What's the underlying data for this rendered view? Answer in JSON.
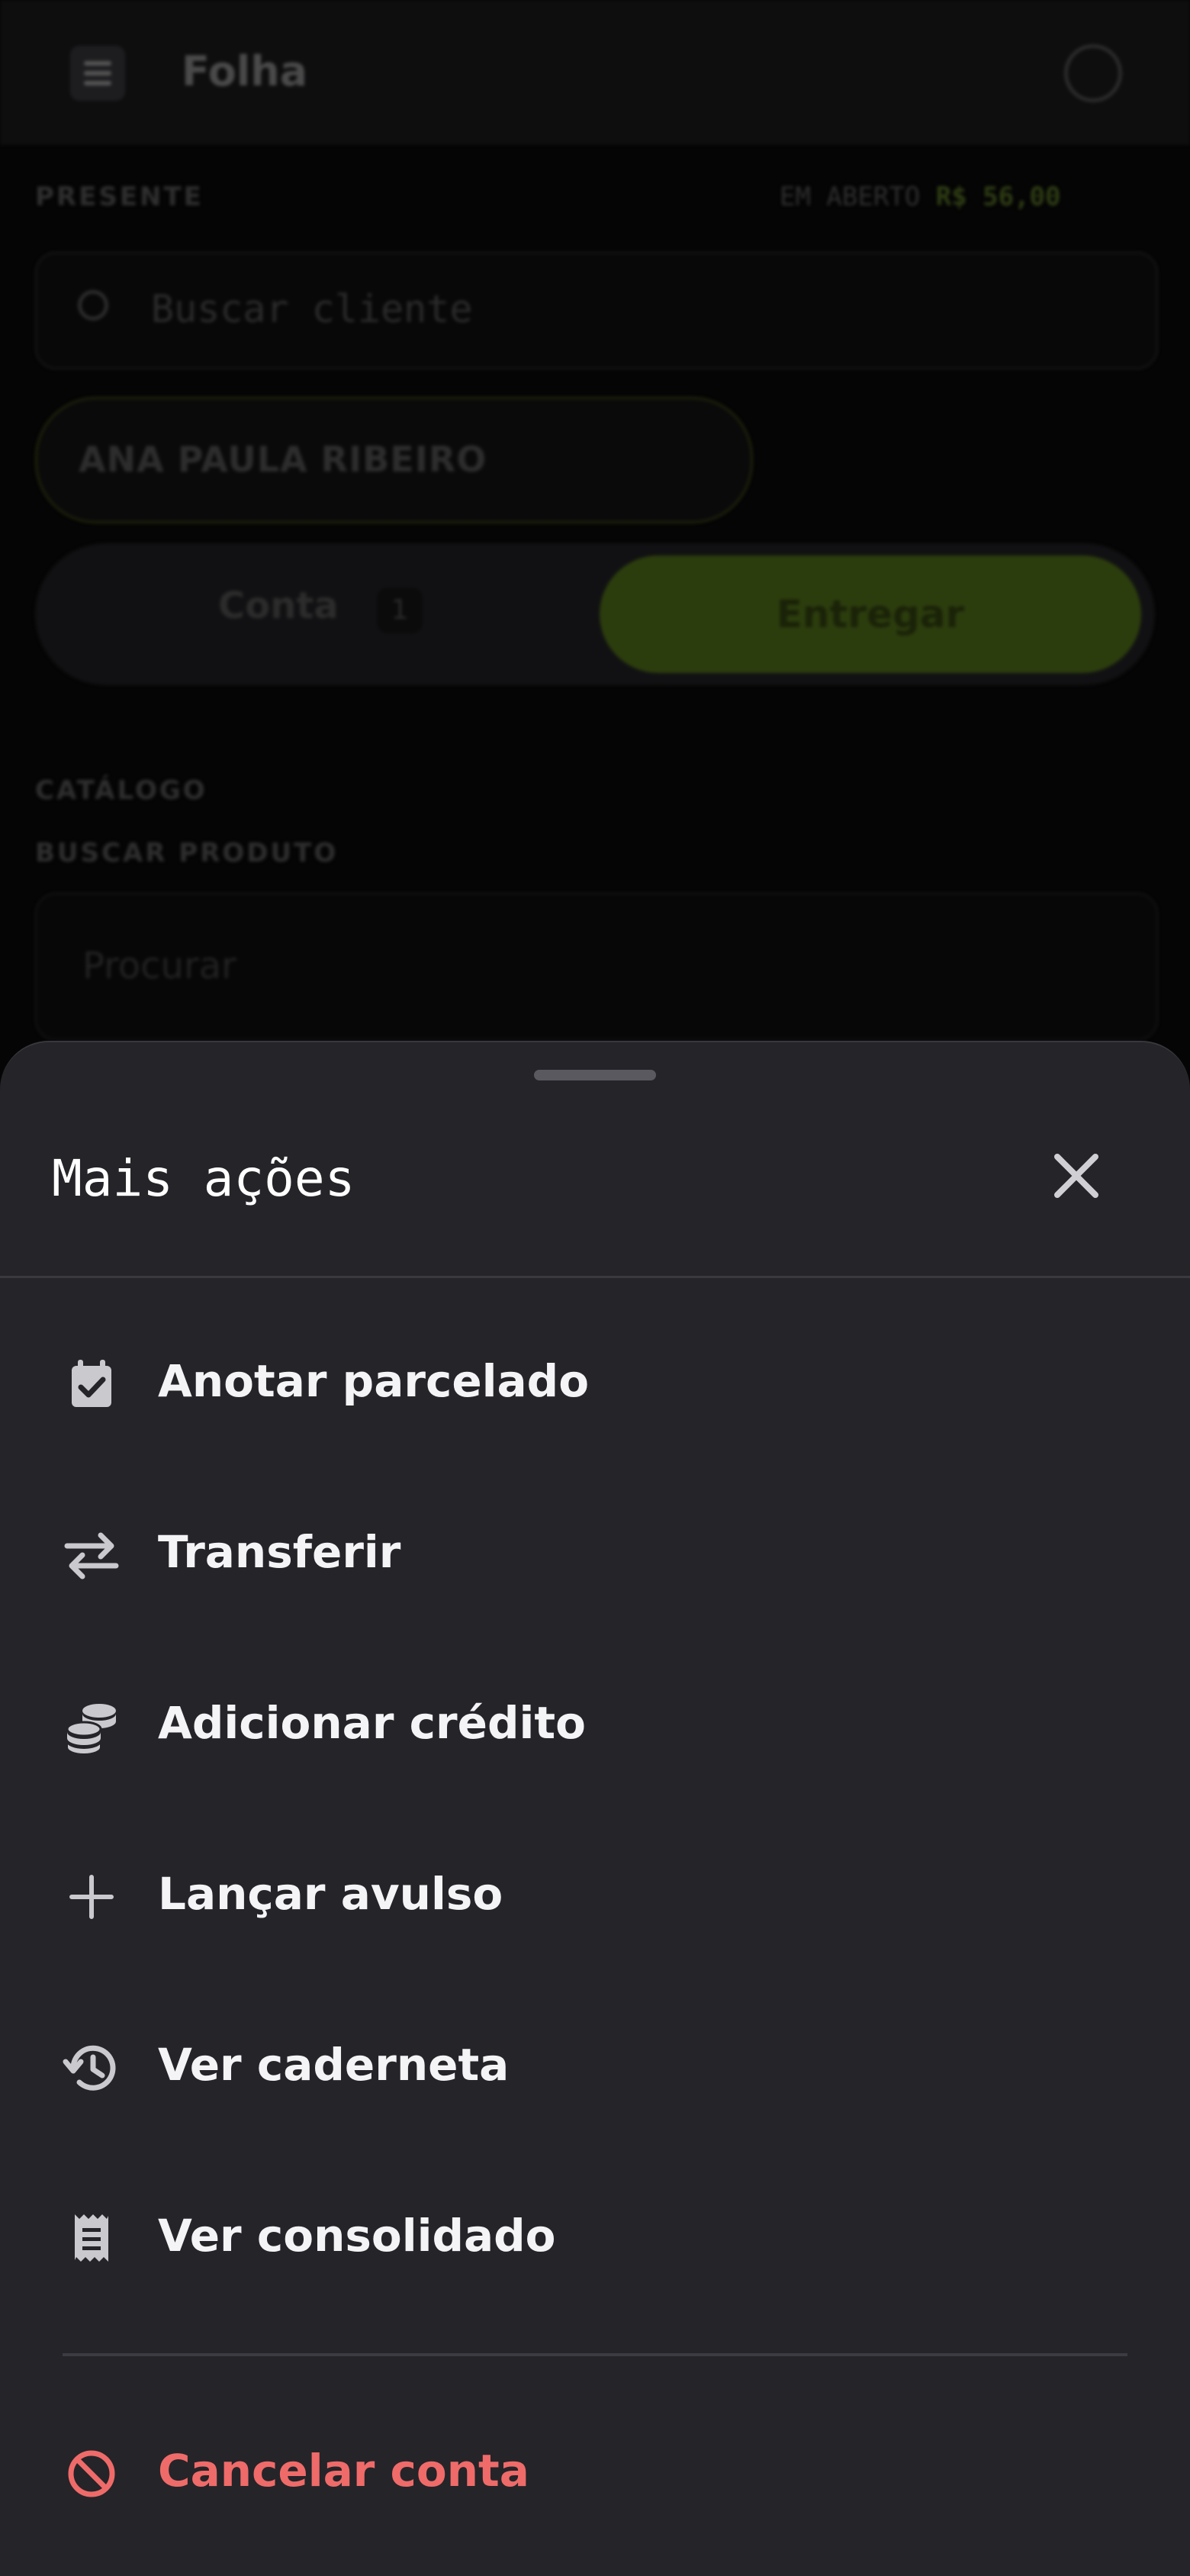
{
  "background": {
    "app_title": "Folha",
    "section_label": "PRESENTE",
    "debt_label": "EM ABERTO",
    "debt_value": "R$ 56,00",
    "search_placeholder": "Buscar cliente",
    "selected_client": "ANA PAULA RIBEIRO",
    "tab_left_label": "Conta",
    "tab_left_badge": "1",
    "tab_right_label": "Entregar",
    "catalog_label": "CATÁLOGO",
    "catalog_sublabel": "BUSCAR PRODUTO",
    "catalog_search_placeholder": "Procurar"
  },
  "sheet": {
    "title": "Mais ações",
    "items": [
      {
        "label": "Anotar parcelado",
        "icon": "calendar-check-icon"
      },
      {
        "label": "Transferir",
        "icon": "swap-arrows-icon"
      },
      {
        "label": "Adicionar crédito",
        "icon": "coins-stack-icon"
      },
      {
        "label": "Lançar avulso",
        "icon": "plus-icon"
      },
      {
        "label": "Ver caderneta",
        "icon": "history-icon"
      },
      {
        "label": "Ver consolidado",
        "icon": "receipt-icon"
      }
    ],
    "danger_item": {
      "label": "Cancelar conta",
      "icon": "block-icon"
    }
  },
  "colors": {
    "sheet_bg": "#252429",
    "danger": "#ee6b69",
    "accent": "#7fb31c"
  }
}
